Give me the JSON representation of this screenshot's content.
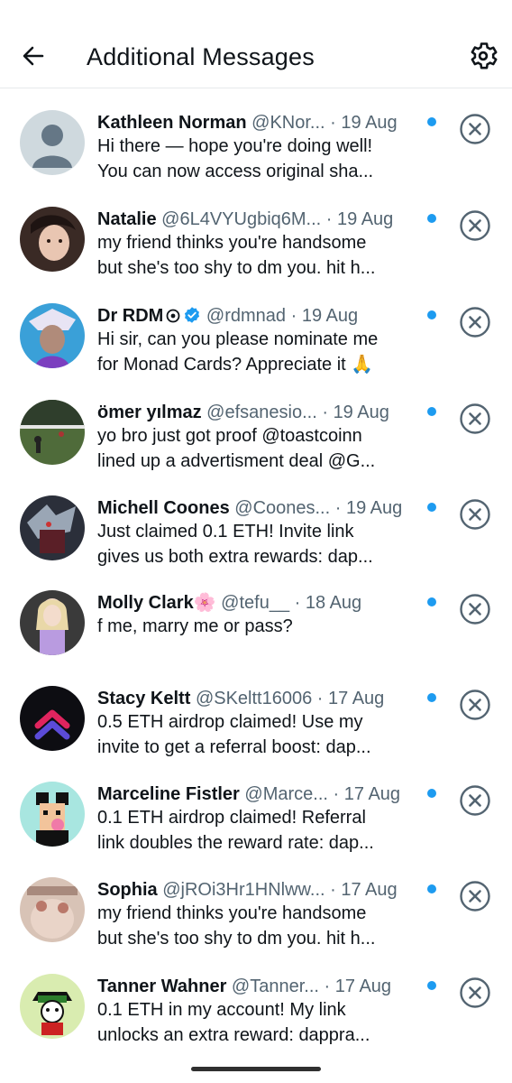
{
  "header": {
    "title": "Additional Messages",
    "back_icon": "arrow-left-icon",
    "settings_icon": "gear-icon"
  },
  "colors": {
    "unread_dot": "#1d9bf0",
    "secondary_text": "#536471",
    "verified_badge": "#1d9bf0"
  },
  "messages": [
    {
      "name": "Kathleen Norman",
      "handle": "@KNor...",
      "separator": "·",
      "date": "19 Aug",
      "line1": "Hi there — hope you're doing well!",
      "line2": "You can now access original sha...",
      "unread": true
    },
    {
      "name": "Natalie",
      "handle": "@6L4VYUgbiq6M...",
      "separator": "·",
      "date": "19 Aug",
      "line1": "my friend thinks you're handsome",
      "line2": "but she's too shy to dm you. hit h...",
      "unread": true
    },
    {
      "name": "Dr RDM",
      "name_badges": [
        "circle-dot-icon",
        "verified-badge-icon"
      ],
      "handle": "@rdmnad",
      "separator": "·",
      "date": "19 Aug",
      "line1": "Hi sir, can you please nominate me",
      "line2": "for Monad Cards? Appreciate it 🙏",
      "unread": true
    },
    {
      "name": "ömer yılmaz",
      "handle": "@efsanesio...",
      "separator": "·",
      "date": "19 Aug",
      "line1": "yo bro just got proof @toastcoinn",
      "line2": "lined up a advertisment deal @G...",
      "unread": true
    },
    {
      "name": "Michell Coones",
      "handle": "@Coones...",
      "separator": "·",
      "date": "19 Aug",
      "line1": "Just claimed 0.1 ETH! Invite link",
      "line2": "gives us both extra rewards: dap...",
      "unread": true
    },
    {
      "name": "Molly Clark🌸",
      "handle": "@tefu__",
      "separator": "·",
      "date": "18 Aug",
      "line1": "f me, marry me or pass?",
      "line2": "",
      "unread": true
    },
    {
      "name": "Stacy Keltt",
      "handle": "@SKeltt16006",
      "separator": "·",
      "date": "17 Aug",
      "line1": "0.5 ETH airdrop claimed! Use my",
      "line2": "invite to get a referral boost: dap...",
      "unread": true
    },
    {
      "name": "Marceline Fistler",
      "handle": "@Marce...",
      "separator": "·",
      "date": "17 Aug",
      "line1": "0.1 ETH airdrop claimed! Referral",
      "line2": "link doubles the reward rate: dap...",
      "unread": true
    },
    {
      "name": "Sophia",
      "handle": "@jROi3Hr1HNlww...",
      "separator": "·",
      "date": "17 Aug",
      "line1": "my friend thinks you're handsome",
      "line2": "but she's too shy to dm you. hit h...",
      "unread": true
    },
    {
      "name": "Tanner Wahner",
      "handle": "@Tanner...",
      "separator": "·",
      "date": "17 Aug",
      "line1": "0.1 ETH in my account! My link",
      "line2": "unlocks an extra reward: dappra...",
      "unread": true
    }
  ]
}
